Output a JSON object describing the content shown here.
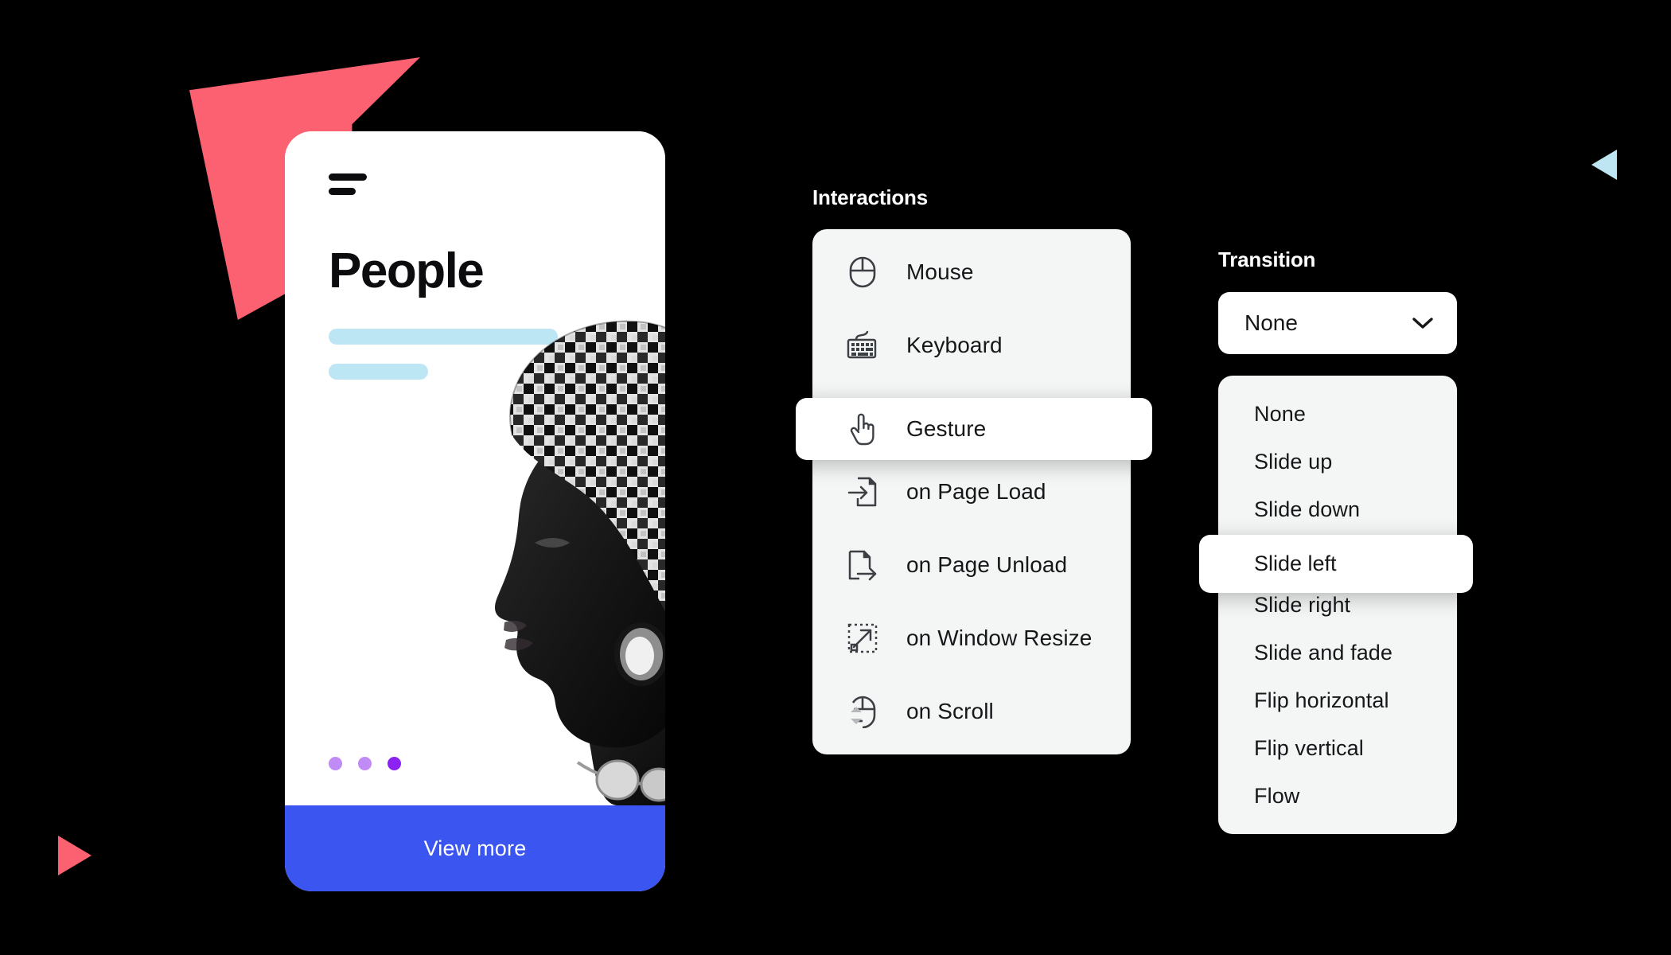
{
  "phone": {
    "menu_icon": "hamburger-icon",
    "title": "People",
    "cta_label": "View more",
    "pagination_dots": 3,
    "active_dot_index": 2,
    "photo_alt": "black and white portrait of a woman wearing a patterned headwrap",
    "colors": {
      "cta_background": "#3b56f0",
      "placeholder_bar": "#bde6f5",
      "dot_inactive": "#c18bf5",
      "dot_active": "#8b22f2"
    }
  },
  "interactions": {
    "heading": "Interactions",
    "selected": "Gesture",
    "items": [
      {
        "label": "Mouse",
        "icon": "mouse-icon"
      },
      {
        "label": "Keyboard",
        "icon": "keyboard-icon"
      },
      {
        "label": "Gesture",
        "icon": "pointing-hand-icon"
      },
      {
        "label": "on Page Load",
        "icon": "page-load-icon"
      },
      {
        "label": "on Page Unload",
        "icon": "page-unload-icon"
      },
      {
        "label": "on Window Resize",
        "icon": "window-resize-icon"
      },
      {
        "label": "on Scroll",
        "icon": "mouse-scroll-icon"
      }
    ]
  },
  "transition": {
    "heading": "Transition",
    "select_value": "None",
    "chevron_icon": "chevron-down-icon",
    "highlighted": "Slide left",
    "options": [
      {
        "label": "None"
      },
      {
        "label": "Slide up"
      },
      {
        "label": "Slide down"
      },
      {
        "label": "Slide left"
      },
      {
        "label": "Slide right"
      },
      {
        "label": "Slide and fade"
      },
      {
        "label": "Flip horizontal"
      },
      {
        "label": "Flip vertical"
      },
      {
        "label": "Flow"
      }
    ]
  },
  "decor": {
    "big_triangle_color": "#fc6172",
    "small_triangle_color": "#fc6172",
    "cyan_triangle_color": "#bde6f2",
    "background_color": "#000000"
  }
}
